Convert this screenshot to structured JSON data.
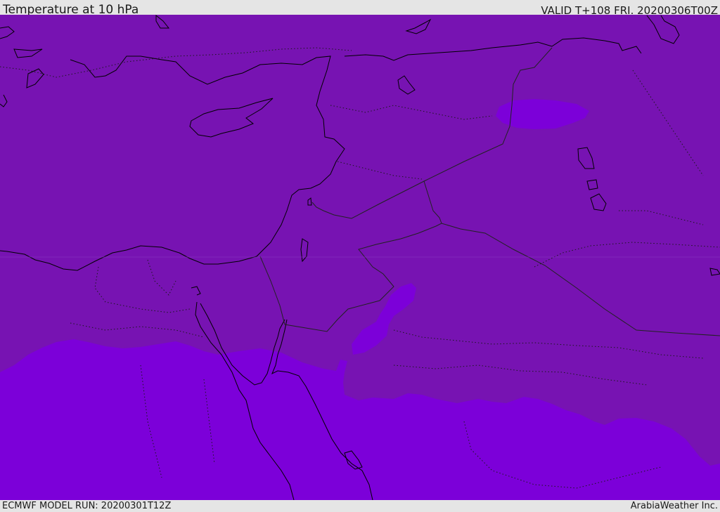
{
  "header": {
    "title": "Temperature at 10 hPa",
    "valid": "VALID T+108 FRI. 20200306T00Z"
  },
  "footer": {
    "model_run": "ECMWF MODEL RUN: 20200301T12Z",
    "credit": "ArabiaWeather Inc."
  },
  "map": {
    "colors": {
      "colder_band": "#7713b2",
      "warmer_band": "#7c00d9",
      "coastline": "#000000",
      "borders": "#222222"
    },
    "region": "Eastern Mediterranean / Middle East"
  }
}
